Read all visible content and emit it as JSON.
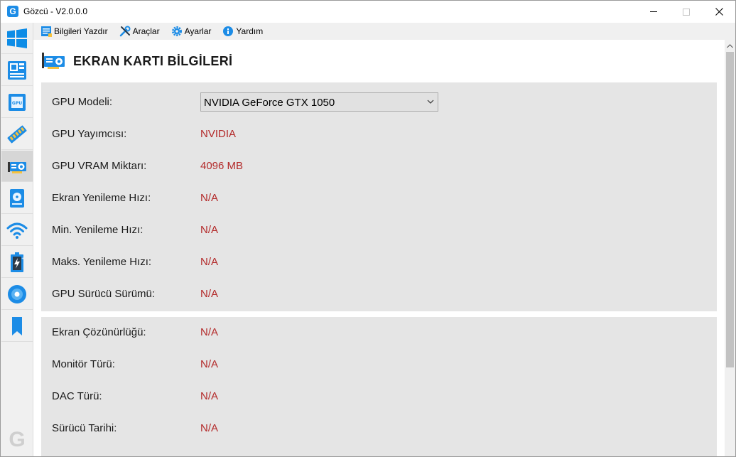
{
  "window": {
    "title": "Gözcü - V2.0.0.0",
    "app_icon_letter": "G",
    "controls": {
      "minimize": "–",
      "maximize": "□",
      "close": "✕"
    }
  },
  "sidebar": {
    "items": [
      {
        "name": "windows-icon",
        "active": false
      },
      {
        "name": "motherboard-icon",
        "active": false
      },
      {
        "name": "cpu-icon",
        "active": false
      },
      {
        "name": "ram-icon",
        "active": false
      },
      {
        "name": "gpu-icon",
        "active": true
      },
      {
        "name": "disk-icon",
        "active": false
      },
      {
        "name": "wifi-icon",
        "active": false
      },
      {
        "name": "battery-icon",
        "active": false
      },
      {
        "name": "disc-icon",
        "active": false
      },
      {
        "name": "bookmark-icon",
        "active": false
      }
    ],
    "bottom_logo": "G"
  },
  "menubar": {
    "items": [
      {
        "label": "Bilgileri Yazdır",
        "icon": "print-report-icon"
      },
      {
        "label": "Araçlar",
        "icon": "tools-icon"
      },
      {
        "label": "Ayarlar",
        "icon": "gear-icon"
      },
      {
        "label": "Yardım",
        "icon": "info-icon"
      }
    ]
  },
  "page": {
    "title": "EKRAN KARTI BİLGİLERİ",
    "title_icon": "gpu-icon"
  },
  "section1": {
    "gpu_model": {
      "label": "GPU Modeli:",
      "selected": "NVIDIA GeForce GTX 1050"
    },
    "rows": [
      {
        "label": "GPU Yayımcısı:",
        "value": "NVIDIA"
      },
      {
        "label": "GPU VRAM Miktarı:",
        "value": "4096 MB"
      },
      {
        "label": "Ekran Yenileme Hızı:",
        "value": "N/A"
      },
      {
        "label": "Min. Yenileme Hızı:",
        "value": "N/A"
      },
      {
        "label": "Maks. Yenileme Hızı:",
        "value": "N/A"
      },
      {
        "label": "GPU Sürücü Sürümü:",
        "value": "N/A"
      }
    ]
  },
  "section2": {
    "rows": [
      {
        "label": "Ekran Çözünürlüğü:",
        "value": "N/A"
      },
      {
        "label": "Monitör Türü:",
        "value": "N/A"
      },
      {
        "label": "DAC Türü:",
        "value": "N/A"
      },
      {
        "label": "Sürücü Tarihi:",
        "value": "N/A"
      }
    ]
  },
  "colors": {
    "accent_blue": "#1c8ce6",
    "value_red": "#b32a2a",
    "section_bg": "#e5e5e5",
    "sidebar_bg": "#f0f0f0"
  }
}
